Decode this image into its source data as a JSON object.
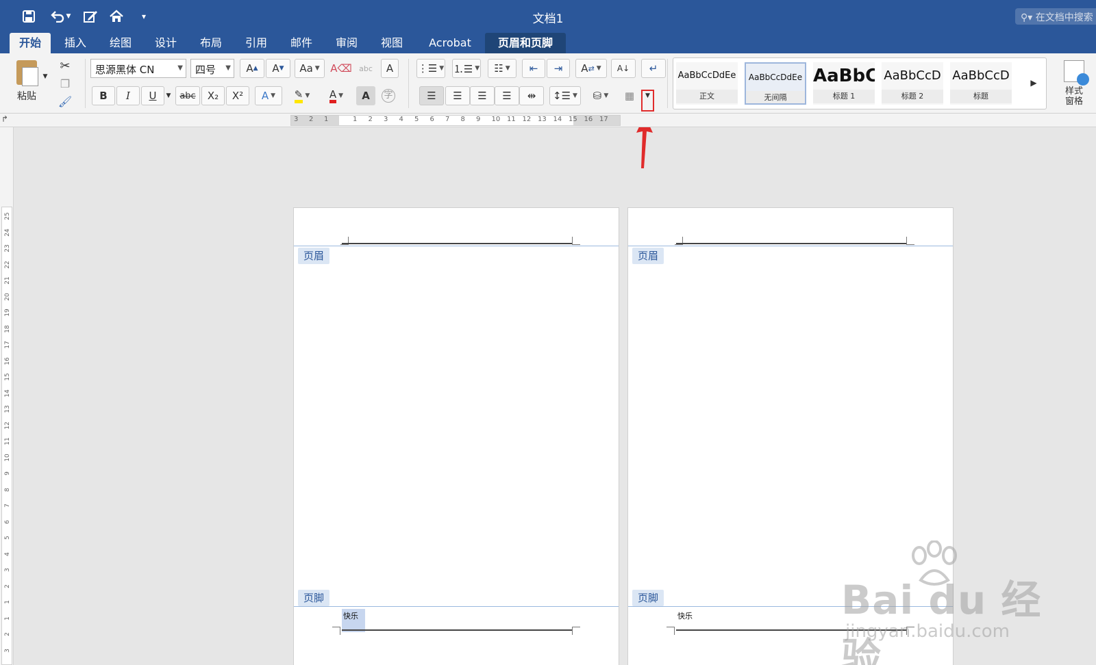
{
  "window": {
    "title": "文档1",
    "search_placeholder": "在文档中搜索"
  },
  "quick_access": [
    "save-icon",
    "undo-icon",
    "edit-icon",
    "home-icon",
    "customize-icon"
  ],
  "tabs": [
    {
      "label": "开始",
      "state": "active"
    },
    {
      "label": "插入"
    },
    {
      "label": "绘图"
    },
    {
      "label": "设计"
    },
    {
      "label": "布局"
    },
    {
      "label": "引用"
    },
    {
      "label": "邮件"
    },
    {
      "label": "审阅"
    },
    {
      "label": "视图"
    },
    {
      "label": "Acrobat"
    },
    {
      "label": "页眉和页脚",
      "state": "contextual"
    }
  ],
  "ribbon": {
    "clipboard": {
      "paste_label": "粘贴"
    },
    "font": {
      "family": "思源黑体 CN",
      "size": "四号",
      "bold": "B",
      "italic": "I",
      "underline": "U",
      "strike": "abc",
      "subscript": "X₂",
      "superscript": "X²",
      "highlight_color": "#ffe600",
      "font_color": "#e02020",
      "char_shading": "A",
      "phonetic": "字"
    },
    "styles": [
      {
        "sample": "AaBbCcDdEe",
        "name": "正文"
      },
      {
        "sample": "AaBbCcDdEe",
        "name": "无间隔",
        "selected": true
      },
      {
        "sample": "AaBbC",
        "name": "标题 1"
      },
      {
        "sample": "AaBbCcD",
        "name": "标题 2"
      },
      {
        "sample": "AaBbCcD",
        "name": "标题"
      }
    ],
    "styles_pane_label": "样式\n窗格"
  },
  "ruler": {
    "horizontal_ticks": [
      "3",
      "2",
      "1",
      "1",
      "2",
      "3",
      "4",
      "5",
      "6",
      "7",
      "8",
      "9",
      "10",
      "11",
      "12",
      "13",
      "14",
      "15",
      "16",
      "17"
    ],
    "vertical_ticks": [
      "25",
      "24",
      "23",
      "22",
      "21",
      "20",
      "19",
      "18",
      "17",
      "16",
      "15",
      "14",
      "13",
      "12",
      "11",
      "10",
      "9",
      "8",
      "7",
      "6",
      "5",
      "4",
      "3",
      "2",
      "1",
      "1",
      "2",
      "3"
    ]
  },
  "pages": [
    {
      "header_label": "页眉",
      "footer_label": "页脚",
      "footer_text": "快乐",
      "footer_selected": true
    },
    {
      "header_label": "页眉",
      "footer_label": "页脚",
      "footer_text": "快乐",
      "footer_selected": false
    }
  ],
  "annotation": {
    "color": "#e02b2b"
  },
  "watermark": {
    "brand": "Bai du 经验",
    "site": "jingyan.baidu.com"
  },
  "colors": {
    "brand_blue": "#2b579a",
    "ribbon_bg": "#f3f3f3"
  }
}
